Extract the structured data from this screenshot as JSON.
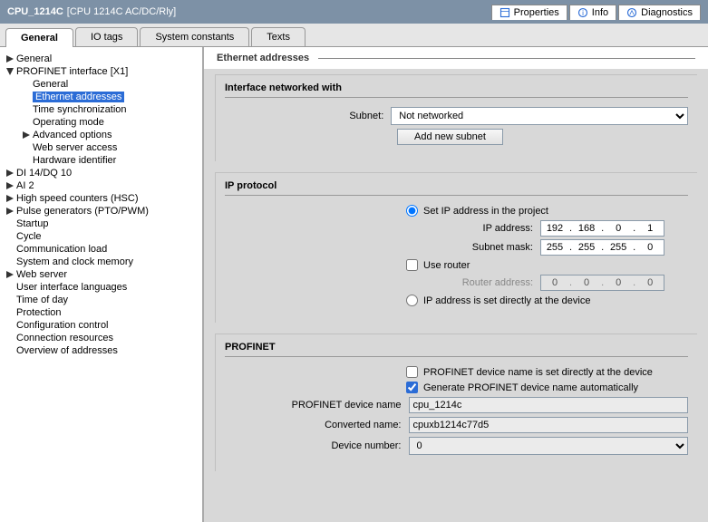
{
  "titlebar": {
    "name": "CPU_1214C",
    "type": "[CPU 1214C AC/DC/Rly]"
  },
  "topTabs": {
    "properties": "Properties",
    "info": "Info",
    "diagnostics": "Diagnostics"
  },
  "secTabs": {
    "general": "General",
    "iotags": "IO tags",
    "sysconst": "System constants",
    "texts": "Texts"
  },
  "tree": {
    "general": "General",
    "profinet": "PROFINET interface [X1]",
    "pn_general": "General",
    "pn_eth": "Ethernet addresses",
    "pn_time": "Time synchronization",
    "pn_op": "Operating mode",
    "pn_adv": "Advanced options",
    "pn_web": "Web server access",
    "pn_hw": "Hardware identifier",
    "di": "DI 14/DQ 10",
    "ai2": "AI 2",
    "hsc": "High speed counters (HSC)",
    "pulse": "Pulse generators (PTO/PWM)",
    "startup": "Startup",
    "cycle": "Cycle",
    "comm": "Communication load",
    "sysclock": "System and clock memory",
    "webserver": "Web server",
    "uilang": "User interface languages",
    "tod": "Time of day",
    "prot": "Protection",
    "cfgctrl": "Configuration control",
    "connres": "Connection resources",
    "ovaddr": "Overview of addresses"
  },
  "content": {
    "heading": "Ethernet addresses",
    "iface": {
      "title": "Interface networked with",
      "subnet_lbl": "Subnet:",
      "subnet_val": "Not networked",
      "add_btn": "Add new subnet"
    },
    "ip": {
      "title": "IP protocol",
      "opt_set": "Set IP address in the project",
      "ip_lbl": "IP address:",
      "ip": [
        "192",
        "168",
        "0",
        "1"
      ],
      "mask_lbl": "Subnet mask:",
      "mask": [
        "255",
        "255",
        "255",
        "0"
      ],
      "use_router": "Use router",
      "router_lbl": "Router address:",
      "router": [
        "0",
        "0",
        "0",
        "0"
      ],
      "opt_direct": "IP address is set directly at the device"
    },
    "pn": {
      "title": "PROFINET",
      "chk_direct": "PROFINET device name is set directly at the device",
      "chk_auto": "Generate PROFINET device name automatically",
      "dev_lbl": "PROFINET device name",
      "dev_val": "cpu_1214c",
      "conv_lbl": "Converted name:",
      "conv_val": "cpuxb1214c77d5",
      "num_lbl": "Device number:",
      "num_val": "0"
    }
  }
}
